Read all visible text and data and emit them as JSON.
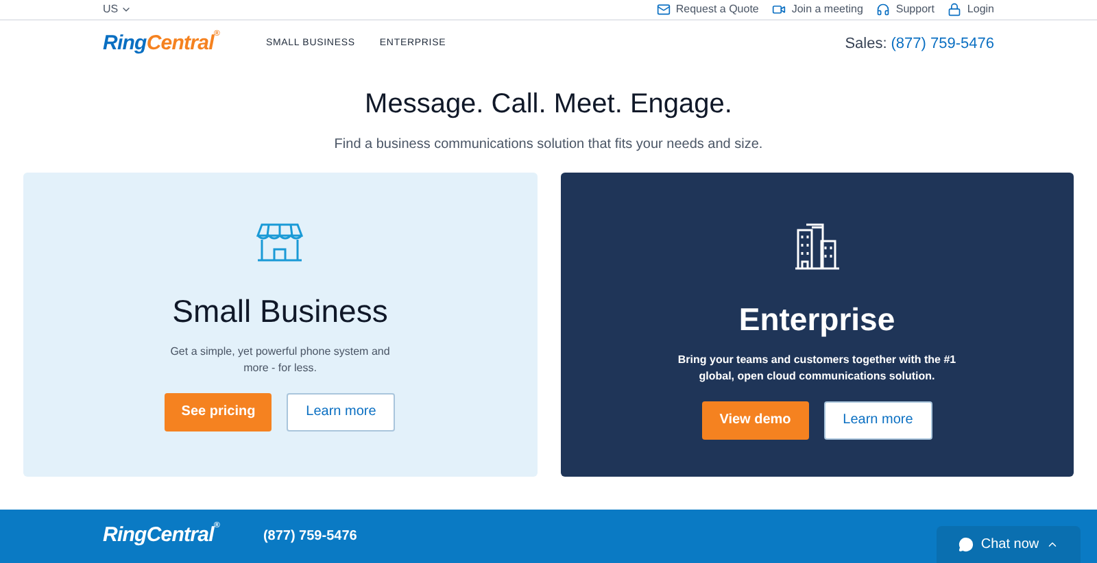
{
  "top_bar": {
    "region": "US",
    "links": [
      {
        "label": "Request a Quote"
      },
      {
        "label": "Join a meeting"
      },
      {
        "label": "Support"
      },
      {
        "label": "Login"
      }
    ]
  },
  "nav": {
    "logo": {
      "first": "Ring",
      "second": "Central",
      "mark": "®"
    },
    "items": [
      "SMALL BUSINESS",
      "ENTERPRISE"
    ],
    "sales_label": "Sales:",
    "sales_phone": "(877) 759-5476"
  },
  "hero": {
    "title": "Message. Call. Meet. Engage.",
    "subtitle": "Find a business communications solution that fits your needs and size."
  },
  "cards": [
    {
      "kind": "light",
      "title": "Small Business",
      "text": "Get a simple, yet powerful phone system and more - for less.",
      "primary": "See pricing",
      "secondary": "Learn more"
    },
    {
      "kind": "dark",
      "title": "Enterprise",
      "text": "Bring your teams and customers together with the #1 global, open cloud communications solution.",
      "primary": "View demo",
      "secondary": "Learn more"
    }
  ],
  "footer": {
    "logo": {
      "first": "Ring",
      "second": "Central",
      "mark": "®"
    },
    "phone": "(877) 759-5476"
  },
  "chat": {
    "label": "Chat now"
  }
}
